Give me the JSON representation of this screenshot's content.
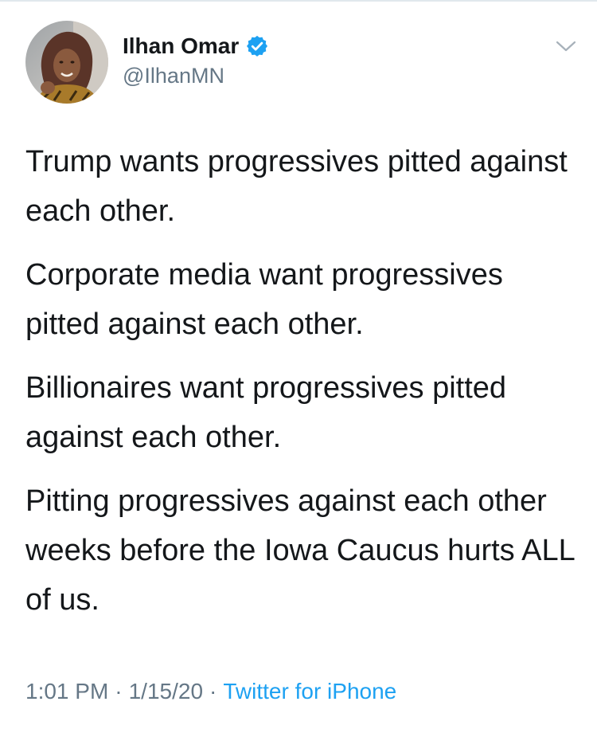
{
  "tweet": {
    "author": {
      "display_name": "Ilhan Omar",
      "handle": "@IlhanMN",
      "verified": true,
      "avatar_icon": "profile-photo"
    },
    "menu_icon": "chevron-down-icon",
    "paragraphs": [
      "Trump wants progressives pitted against each other.",
      "Corporate media want progressives pitted against each other.",
      "Billionaires want progressives pitted against each other.",
      "Pitting progressives against each other weeks before the Iowa Caucus hurts ALL of us."
    ],
    "time": "1:01 PM",
    "separator": "·",
    "date": "1/15/20",
    "source": "Twitter for iPhone"
  },
  "colors": {
    "text_primary": "#14171a",
    "text_secondary": "#657786",
    "link_blue": "#1da1f2",
    "verified_blue": "#1da1f2"
  }
}
